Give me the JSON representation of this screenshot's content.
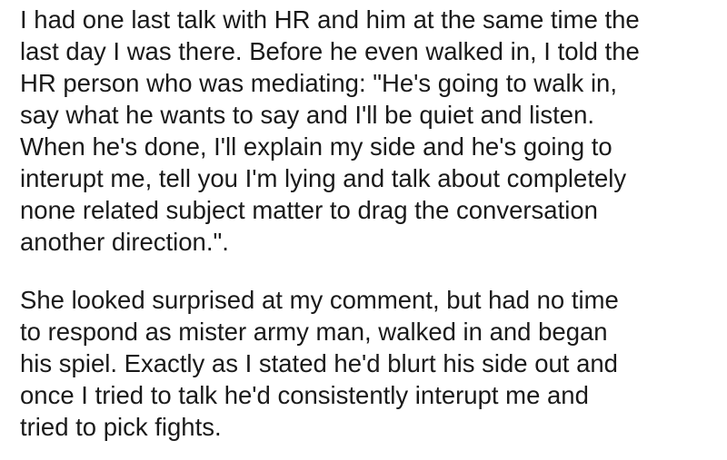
{
  "paragraphs": [
    {
      "lines": [
        "I had one last talk with HR and him at the same time the",
        "last day I was there. Before he even walked in, I told the",
        "HR person who was mediating: \"He's going to walk in,",
        "say what he wants to say and I'll be quiet and listen.",
        "When he's done, I'll explain my side and he's going to",
        "interupt me, tell you I'm lying and talk about completely",
        "none related subject matter to drag the conversation",
        "another direction.\"."
      ]
    },
    {
      "lines": [
        "She looked surprised at my comment, but had no time",
        "to respond as mister army man, walked in and began",
        "his spiel. Exactly as I stated he'd blurt his side out and",
        "once I tried to talk he'd consistently interupt me and",
        "tried to pick fights."
      ]
    }
  ]
}
